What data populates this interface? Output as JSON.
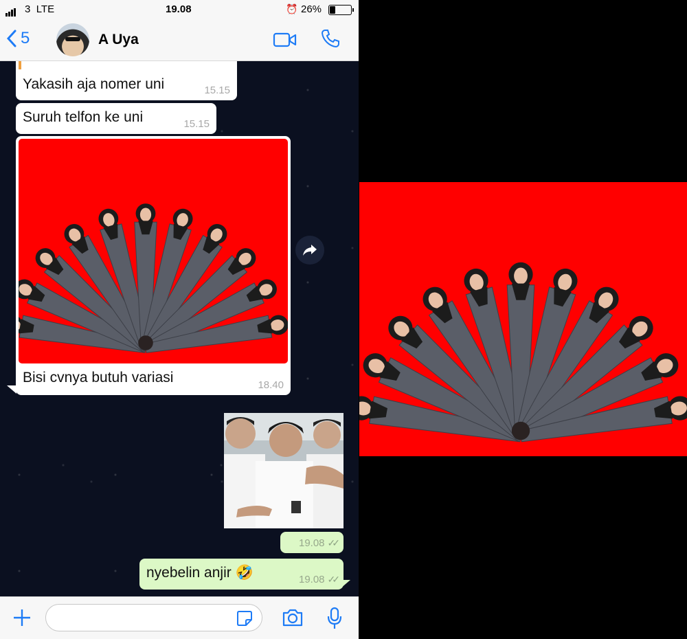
{
  "status_bar": {
    "carrier": "3",
    "network": "LTE",
    "time": "19.08",
    "battery_percent": "26%",
    "battery_level": 0.26
  },
  "nav": {
    "back_count": "5",
    "contact_name": "A Uya",
    "icons": [
      "chevron-left-icon",
      "video-call-icon",
      "phone-call-icon"
    ]
  },
  "messages": [
    {
      "direction": "in",
      "text": "Yakasih aja nomer uni",
      "time": "15.15"
    },
    {
      "direction": "in",
      "text": "Suruh telfon ke uni",
      "time": "15.15"
    },
    {
      "direction": "in",
      "type": "image",
      "caption": "Bisi cvnya butuh variasi",
      "time": "18.40"
    },
    {
      "direction": "out",
      "type": "sticker",
      "time": "19.08",
      "status": "read"
    },
    {
      "direction": "out",
      "text": "nyebelin anjir 🤣",
      "time": "19.08",
      "status": "read"
    }
  ],
  "colors": {
    "accent": "#1d7bf6",
    "outgoing_bubble": "#dcf8c6",
    "incoming_bubble": "#ffffff",
    "photo_background": "#ff0000"
  },
  "input": {
    "placeholder": "",
    "icons": [
      "plus-icon",
      "sticker-icon",
      "camera-icon",
      "microphone-icon"
    ]
  }
}
